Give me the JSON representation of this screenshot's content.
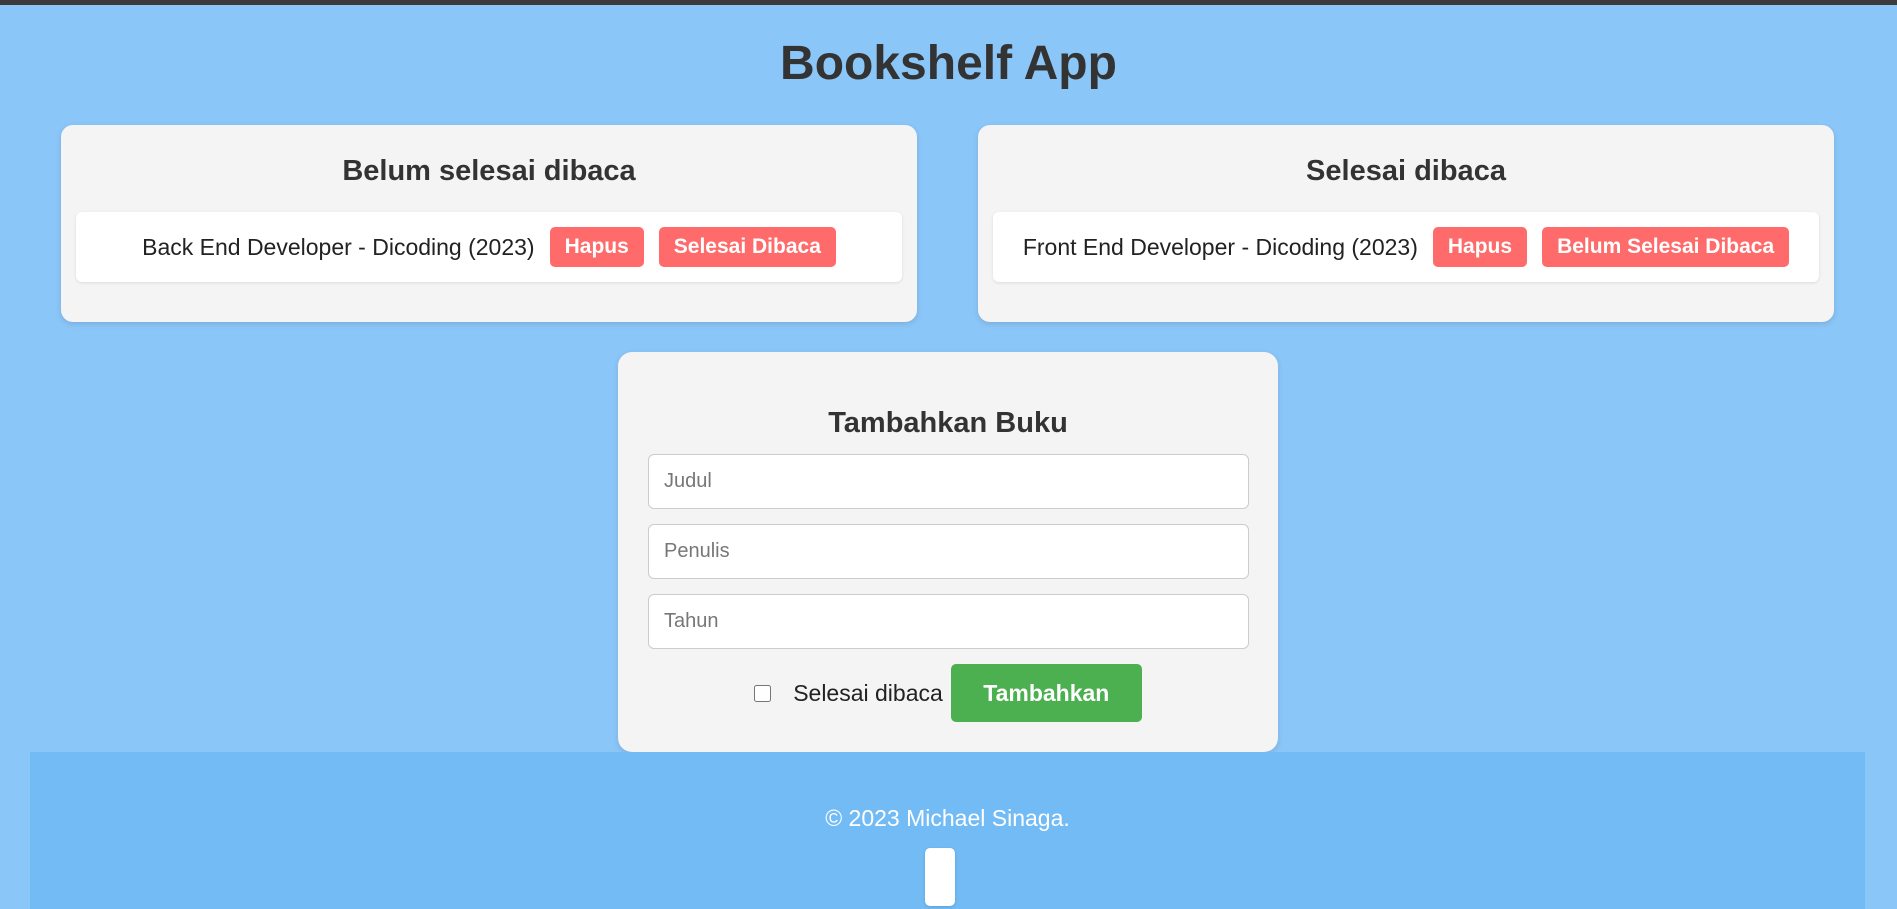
{
  "header": {
    "title": "Bookshelf App"
  },
  "incomplete_shelf": {
    "title": "Belum selesai dibaca",
    "books": [
      {
        "text": "Back End Developer - Dicoding (2023)",
        "delete_label": "Hapus",
        "toggle_label": "Selesai Dibaca"
      }
    ]
  },
  "complete_shelf": {
    "title": "Selesai dibaca",
    "books": [
      {
        "text": "Front End Developer - Dicoding (2023)",
        "delete_label": "Hapus",
        "toggle_label": "Belum Selesai Dibaca"
      }
    ]
  },
  "form": {
    "title": "Tambahkan Buku",
    "title_placeholder": "Judul",
    "author_placeholder": "Penulis",
    "year_placeholder": "Tahun",
    "checkbox_label": "Selesai dibaca",
    "checkbox_checked": false,
    "submit_label": "Tambahkan"
  },
  "footer": {
    "text": "© 2023 Michael Sinaga."
  },
  "colors": {
    "background": "#8bc6f8",
    "card": "#f4f4f4",
    "danger": "#ff6b6b",
    "success": "#4caf50",
    "footer": "#72bbf5"
  }
}
